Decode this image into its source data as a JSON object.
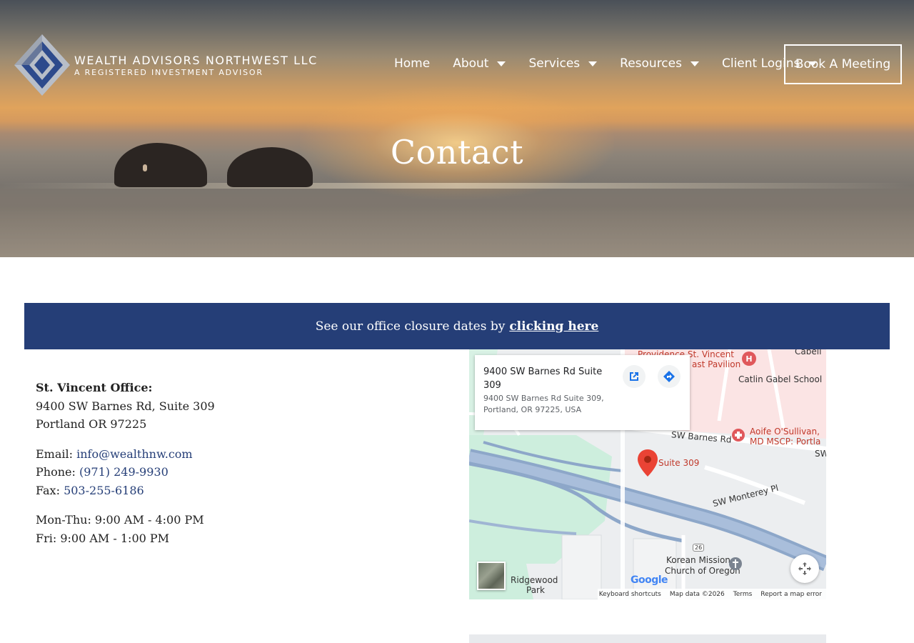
{
  "brand": {
    "name": "Wealth Advisors Northwest LLC",
    "tagline": "A Registered Investment Advisor",
    "colors": {
      "navy": "#253e77",
      "logo_blue": "#2d4a8c",
      "logo_gray": "#b8bec8"
    }
  },
  "nav": {
    "items": [
      {
        "label": "Home",
        "has_dropdown": false
      },
      {
        "label": "About",
        "has_dropdown": true
      },
      {
        "label": "Services",
        "has_dropdown": true
      },
      {
        "label": "Resources",
        "has_dropdown": true
      },
      {
        "label": "Client Logins",
        "has_dropdown": true
      }
    ],
    "cta_label": "Book A Meeting"
  },
  "hero": {
    "title": "Contact"
  },
  "banner": {
    "text": "See our office closure dates by",
    "link_label": "clicking here"
  },
  "office": {
    "heading": "St. Vincent Office:",
    "address_line1": "9400 SW Barnes Rd, Suite 309",
    "address_line2": "Portland OR 97225",
    "email_label": "Email:",
    "email": "info@wealthnw.com",
    "phone_label": "Phone:",
    "phone": "(971) 249-9930",
    "fax_label": "Fax:",
    "fax": "503-255-6186",
    "hours_line1": "Mon-Thu: 9:00 AM - 4:00 PM",
    "hours_line2": "Fri: 9:00 AM - 1:00 PM"
  },
  "map": {
    "card_title": "9400 SW Barnes Rd Suite 309",
    "card_address": "9400 SW Barnes Rd Suite 309, Portland, OR 97225, USA",
    "pin_label": "Suite 309",
    "labels": {
      "providence": "Providence St. Vincent",
      "pavilion": "ast Pavilion",
      "cabell": "Cabell",
      "catlin": "Catlin Gabel School",
      "barnes": "SW Barnes Rd",
      "aoife1": "Aoife O'Sullivan,",
      "aoife2": "MD MSCP: Portla",
      "monterey": "SW Monterey Pl",
      "route": "26",
      "korean1": "Korean Mission",
      "korean2": "Church of Oregon",
      "ridgewood1": "Ridgewood",
      "ridgewood2": "Park",
      "sw": "SW"
    },
    "google": "Google",
    "footer": {
      "shortcuts": "Keyboard shortcuts",
      "data": "Map data ©2026",
      "terms": "Terms",
      "report": "Report a map error"
    },
    "icons": {
      "open": "open-in-new-icon",
      "directions": "directions-icon",
      "fullscreen": "fullscreen-icon",
      "pin": "map-pin-icon",
      "hospital": "hospital-icon",
      "medical": "medical-icon",
      "church": "church-icon"
    }
  }
}
